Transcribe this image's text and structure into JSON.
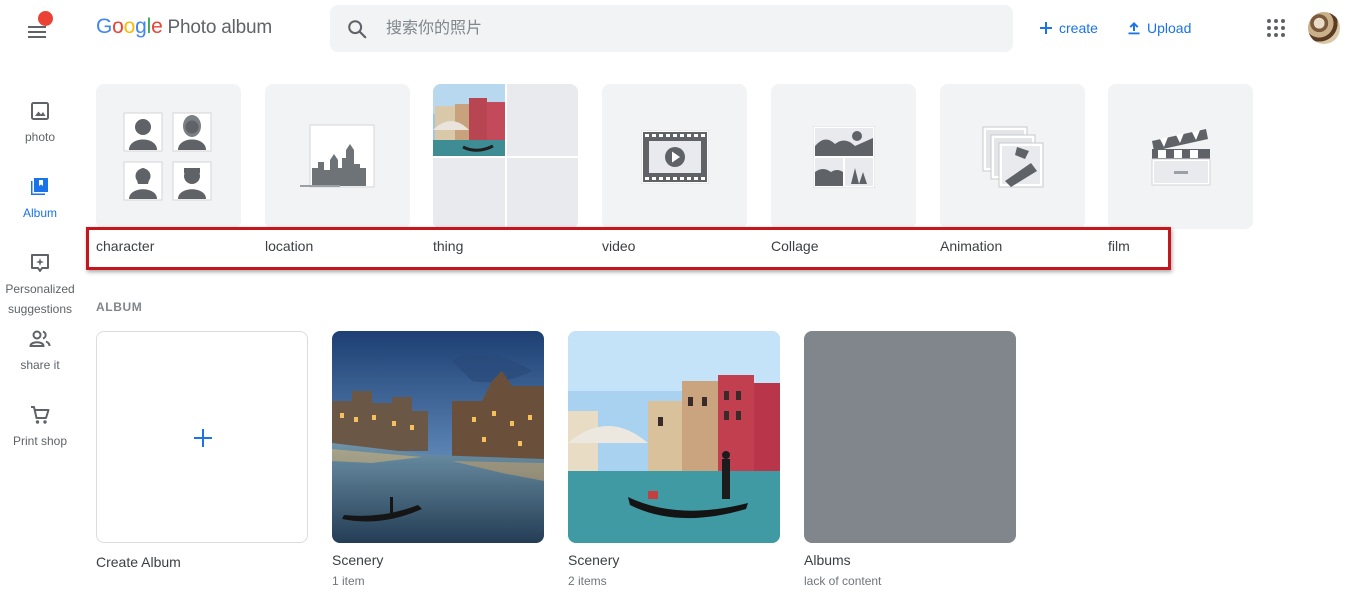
{
  "header": {
    "logo_parts": [
      "G",
      "o",
      "o",
      "g",
      "l",
      "e"
    ],
    "product": "Photo album",
    "search_placeholder": "搜索你的照片",
    "create_label": "create",
    "upload_label": "Upload",
    "icons": [
      "menu-icon",
      "search-icon",
      "plus-icon",
      "upload-icon",
      "apps-icon",
      "avatar"
    ]
  },
  "sidebar": {
    "items": [
      {
        "label": "photo",
        "icon": "photo-icon"
      },
      {
        "label": "Album",
        "icon": "album-icon",
        "active": true
      },
      {
        "label": "Personalized suggestions",
        "icon": "suggestions-icon"
      },
      {
        "label": "share it",
        "icon": "share-icon"
      },
      {
        "label": "Print shop",
        "icon": "cart-icon"
      }
    ]
  },
  "categories": [
    {
      "label": "character",
      "icon": "people-icon"
    },
    {
      "label": "location",
      "icon": "city-icon"
    },
    {
      "label": "thing",
      "icon": "things-collage"
    },
    {
      "label": "video",
      "icon": "video-icon"
    },
    {
      "label": "Collage",
      "icon": "collage-icon"
    },
    {
      "label": "Animation",
      "icon": "animation-icon"
    },
    {
      "label": "film",
      "icon": "clapperboard-icon"
    }
  ],
  "section": {
    "album_header": "ALBUM"
  },
  "albums": [
    {
      "title": "Create Album",
      "sub": ""
    },
    {
      "title": "Scenery",
      "sub": "1 item"
    },
    {
      "title": "Scenery",
      "sub": "2 items"
    },
    {
      "title": "Albums",
      "sub": "lack of content"
    }
  ],
  "colors": {
    "accent": "#1a73e8",
    "highlight_border": "#c5161d",
    "notification_dot": "#ea4335",
    "tile_bg": "#f1f3f4",
    "empty_album": "#80868b"
  }
}
